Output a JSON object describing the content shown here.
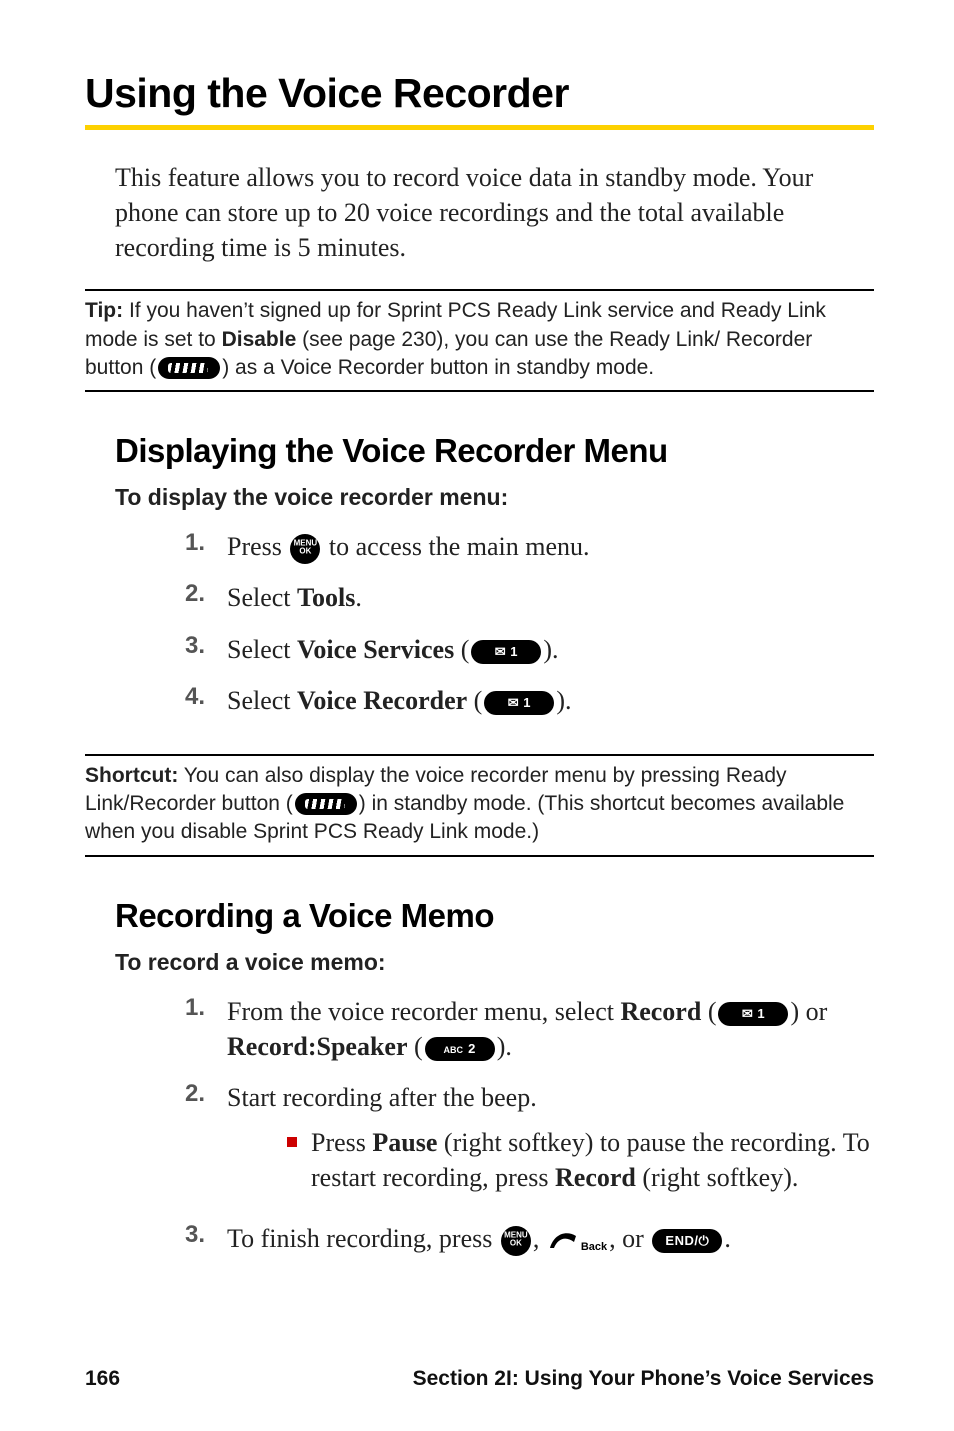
{
  "title": "Using the Voice Recorder",
  "intro": "This feature allows you to record voice data in standby mode. Your phone can store up to 20 voice recordings and the total available recording time is 5 minutes.",
  "tip": {
    "label": "Tip:",
    "before": " If you haven’t signed up for Sprint PCS Ready Link service and Ready Link mode is set to ",
    "bold": "Disable",
    "afterA": " (see page 230), you can use the Ready Link/ Recorder button (",
    "afterB": ") as a Voice Recorder button in standby mode."
  },
  "section1": {
    "heading": "Displaying the Voice Recorder Menu",
    "lead": "To display the voice recorder menu:",
    "steps": [
      {
        "n": "1.",
        "preA": "Press ",
        "icon": "menu-ok",
        "preB": " to access the main menu."
      },
      {
        "n": "2.",
        "preA": "Select ",
        "bold": "Tools",
        "preB": "."
      },
      {
        "n": "3.",
        "preA": "Select ",
        "bold": "Voice Services",
        "preB": " (",
        "key": "mail1",
        "preC": ")."
      },
      {
        "n": "4.",
        "preA": "Select ",
        "bold": "Voice Recorder",
        "preB": " (",
        "key": "mail1",
        "preC": ")."
      }
    ]
  },
  "shortcut": {
    "label": "Shortcut:",
    "before": " You can also display the voice recorder menu by pressing Ready Link/Recorder button (",
    "after": ") in standby mode. (This shortcut becomes available when you disable Sprint PCS Ready Link mode.)"
  },
  "section2": {
    "heading": "Recording a Voice Memo",
    "lead": "To record a voice memo:",
    "steps": [
      {
        "n": "1.",
        "preA": "From the voice recorder menu, select ",
        "bold1": "Record",
        "preB": " (",
        "key1": "mail1",
        "preC": ") or ",
        "bold2": "Record:Speaker",
        "preD": " (",
        "key2": "abc2",
        "preE": ")."
      },
      {
        "n": "2.",
        "preA": "Start recording after the beep.",
        "sub": {
          "preA": "Press ",
          "bold1": "Pause",
          "preB": " (right softkey) to pause the recording. To restart recording, press ",
          "bold2": "Record",
          "preC": " (right softkey)."
        }
      },
      {
        "n": "3.",
        "preA": "To finish recording, press ",
        "icon1": "menu-ok",
        "preB": ", ",
        "icon2": "back",
        "preC": ", or ",
        "key": "end",
        "preD": "."
      }
    ]
  },
  "footer": {
    "page": "166",
    "section": "Section 2I: Using Your Phone’s Voice Services"
  },
  "icons": {
    "menuok_line1": "MENU",
    "menuok_line2": "OK",
    "key_mail1": "✉ 1",
    "key_abc2_tiny": "ABC",
    "key_abc2_big": " 2",
    "key_end": "END/⏻",
    "back_label": "Back"
  }
}
